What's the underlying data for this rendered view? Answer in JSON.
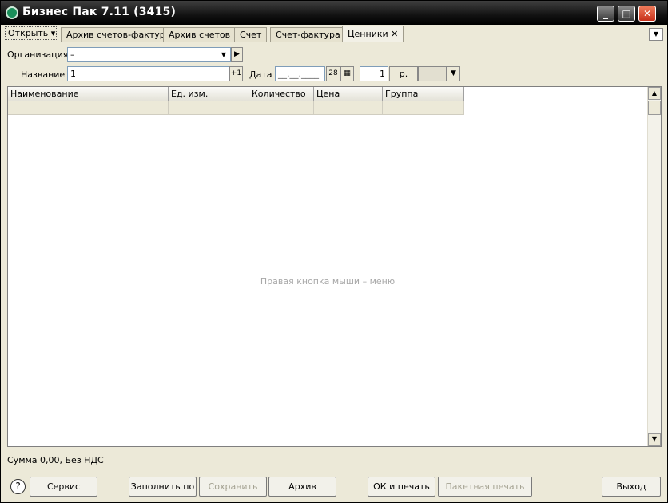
{
  "window": {
    "title": "Бизнес Пак 7.11 (3415)",
    "minimize": "_",
    "maximize": "□",
    "close": "✕"
  },
  "toolbar": {
    "open_label": "Открыть",
    "open_arrow": "▾",
    "tabs": [
      {
        "label": "Архив счетов-фактур"
      },
      {
        "label": "Архив счетов"
      },
      {
        "label": "Счет"
      },
      {
        "label": "Счет-фактура"
      },
      {
        "label": "Ценники",
        "close": "✕",
        "active": true
      }
    ],
    "tabs_menu_arrow": "▼"
  },
  "form": {
    "organization_label": "Организация",
    "organization_value": "–",
    "dropdown_arrow": "▼",
    "play_arrow": "▶",
    "name_label": "Название",
    "name_value": "1",
    "plus_one": "+1",
    "date_label": "Дата",
    "date_value": "__.__.____",
    "calendar_day": "28",
    "calendar_grid": "▦",
    "qty_value": "1",
    "currency": "р.",
    "currency_arrow": "▼"
  },
  "grid": {
    "columns": [
      "Наименование",
      "Ед. изм.",
      "Количество",
      "Цена",
      "Группа"
    ],
    "hint": "Правая кнопка мыши – меню",
    "scroll_up": "▲",
    "scroll_down": "▼"
  },
  "status": {
    "sum": "Сумма 0,00, Без НДС"
  },
  "buttons": {
    "help": "?",
    "service": "Сервис",
    "fill_by": "Заполнить по",
    "save": "Сохранить",
    "archive": "Архив",
    "ok_print": "ОК и печать",
    "batch_print": "Пакетная печать",
    "exit": "Выход"
  }
}
